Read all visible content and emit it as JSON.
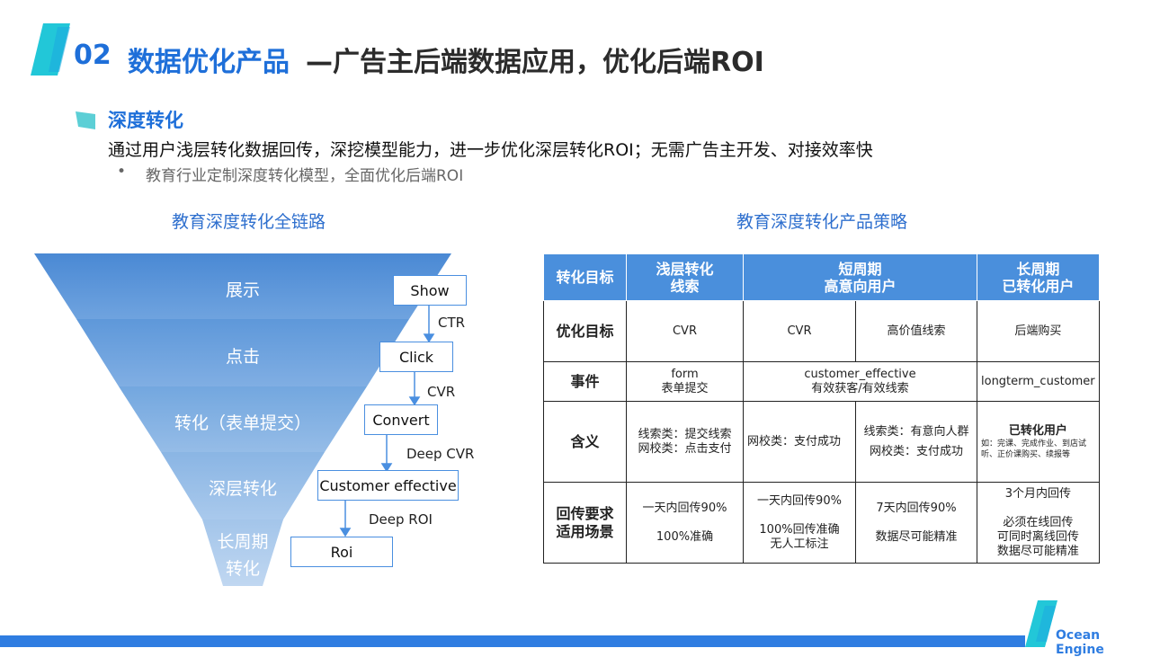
{
  "header": {
    "number": "02",
    "title": "数据优化产品",
    "subtitle": "—广告主后端数据应用，优化后端ROI"
  },
  "section": {
    "title": "深度转化",
    "description": "通过用户浅层转化数据回传，深挖模型能力，进一步优化深层转化ROI；无需广告主开发、对接效率快",
    "bullet": "•",
    "bullet_text": "教育行业定制深度转化模型，全面优化后端ROI"
  },
  "funnel": {
    "heading": "教育深度转化全链路",
    "levels": [
      "展示",
      "点击",
      "转化（表单提交）",
      "深层转化",
      "长周期",
      "转化"
    ],
    "boxes": [
      "Show",
      "Click",
      "Convert",
      "Customer effective",
      "Roi"
    ],
    "arrows": [
      "CTR",
      "CVR",
      "Deep CVR",
      "Deep ROI"
    ]
  },
  "strategy": {
    "heading": "教育深度转化产品策略",
    "header": [
      "转化目标",
      "浅层转化",
      "线索",
      "短周期",
      "高意向用户",
      "长周期",
      "已转化用户"
    ],
    "rows": {
      "goal": [
        "优化目标",
        "CVR",
        "CVR",
        "高价值线索",
        "后端购买"
      ],
      "event": [
        "事件",
        "form",
        "表单提交",
        "customer_effective",
        "有效获客/有效线索",
        "longterm_customer"
      ],
      "meaning": [
        "含义",
        "线索类：提交线索",
        "网校类：点击支付",
        "网校类：支付成功",
        "线索类：有意向人群",
        "网校类：支付成功",
        "已转化用户",
        "如：完课、完成作业、到店试听、正价课购买、续报等"
      ],
      "scenario": [
        "回传要求",
        "适用场景",
        "一天内回传90%",
        "100%准确",
        "一天内回传90%",
        "100%回传准确",
        "无人工标注",
        "7天内回传90%",
        "数据尽可能精准",
        "3个月内回传",
        "必须在线回传",
        "可同时离线回传",
        "数据尽可能精准"
      ]
    }
  },
  "footer": {
    "logo_text": "Ocean Engine"
  },
  "colors": {
    "accent": "#1E6FD9",
    "funnel_top": "#4F8ED6",
    "funnel_bottom": "#B9D4F0",
    "table_header": "#4A8FDC",
    "decor": "#22C7D8"
  }
}
